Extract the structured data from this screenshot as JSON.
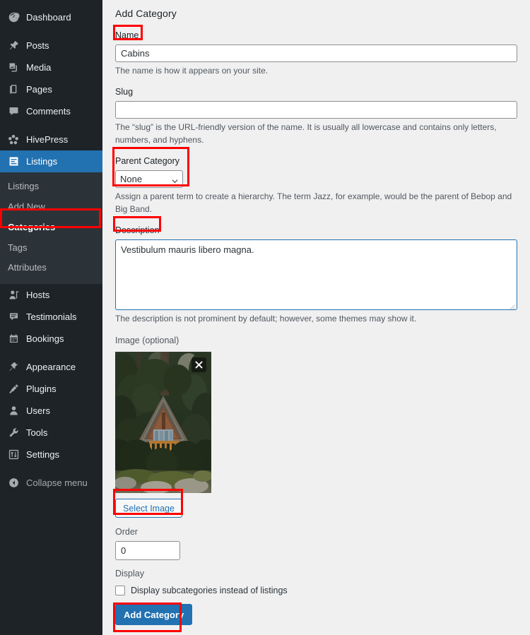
{
  "sidebar": {
    "items": [
      {
        "label": "Dashboard",
        "icon": "dashboard-icon"
      },
      {
        "label": "Posts",
        "icon": "pin-icon"
      },
      {
        "label": "Media",
        "icon": "media-icon"
      },
      {
        "label": "Pages",
        "icon": "pages-icon"
      },
      {
        "label": "Comments",
        "icon": "comments-icon"
      },
      {
        "label": "HivePress",
        "icon": "hivepress-icon"
      },
      {
        "label": "Listings",
        "icon": "listings-icon"
      },
      {
        "label": "Hosts",
        "icon": "hosts-icon"
      },
      {
        "label": "Testimonials",
        "icon": "testimonials-icon"
      },
      {
        "label": "Bookings",
        "icon": "bookings-icon"
      },
      {
        "label": "Appearance",
        "icon": "appearance-icon"
      },
      {
        "label": "Plugins",
        "icon": "plugins-icon"
      },
      {
        "label": "Users",
        "icon": "users-icon"
      },
      {
        "label": "Tools",
        "icon": "tools-icon"
      },
      {
        "label": "Settings",
        "icon": "settings-icon"
      },
      {
        "label": "Collapse menu",
        "icon": "collapse-icon"
      }
    ],
    "submenu": [
      {
        "label": "Listings",
        "current": false
      },
      {
        "label": "Add New",
        "current": false
      },
      {
        "label": "Categories",
        "current": true
      },
      {
        "label": "Tags",
        "current": false
      },
      {
        "label": "Attributes",
        "current": false
      }
    ],
    "colors": {
      "background": "#1d2327",
      "submenu_background": "#2c3338",
      "current_highlight": "#2271b1"
    }
  },
  "main": {
    "page_title": "Add Category",
    "name": {
      "label": "Name",
      "value": "Cabins",
      "help": "The name is how it appears on your site."
    },
    "slug": {
      "label": "Slug",
      "value": "",
      "placeholder": "",
      "help": "The “slug” is the URL-friendly version of the name. It is usually all lowercase and contains only letters, numbers, and hyphens."
    },
    "parent_category": {
      "label": "Parent Category",
      "selected": "None",
      "options": [
        "None"
      ],
      "help": "Assign a parent term to create a hierarchy. The term Jazz, for example, would be the parent of Bebop and Big Band."
    },
    "description": {
      "label": "Description",
      "value": "Vestibulum mauris libero magna.",
      "help": "The description is not prominent by default; however, some themes may show it."
    },
    "image": {
      "label": "Image (optional)",
      "remove_icon": "close-icon",
      "select_button": "Select Image",
      "alt": "A-frame wooden cabin in an evergreen forest"
    },
    "order": {
      "label": "Order",
      "value": "0"
    },
    "display": {
      "label": "Display",
      "checkbox_label": "Display subcategories instead of listings",
      "checked": false
    },
    "submit_button": "Add Category",
    "colors": {
      "accent": "#2271b1",
      "page_background": "#f0f0f1",
      "annotation": "#ff0000"
    }
  },
  "annotations": [
    {
      "target": "name-label"
    },
    {
      "target": "parent-category-group"
    },
    {
      "target": "sidebar-item-categories"
    },
    {
      "target": "description-label"
    },
    {
      "target": "select-image-button"
    },
    {
      "target": "add-category-button"
    }
  ]
}
